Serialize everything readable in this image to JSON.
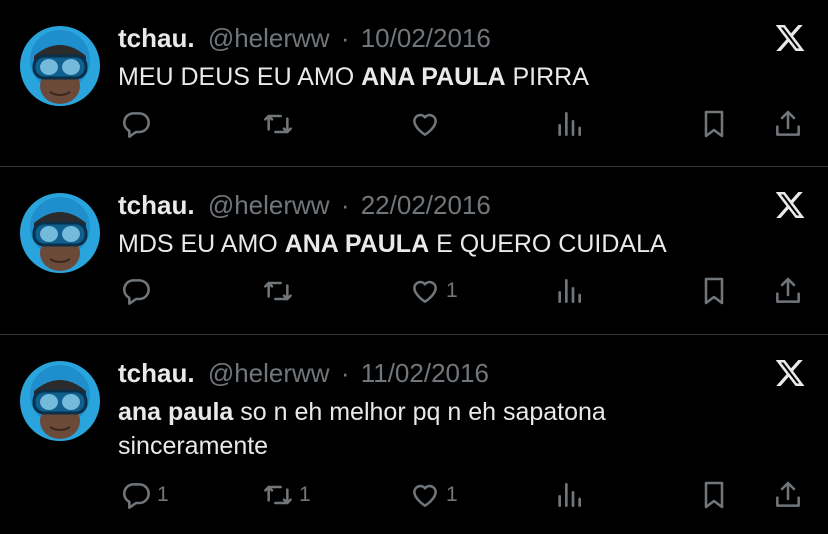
{
  "tweets": [
    {
      "name": "tchau.",
      "handle": "@helerww",
      "sep": "·",
      "date": "10/02/2016",
      "text_pre": "MEU DEUS EU AMO ",
      "text_bold": "ANA PAULA",
      "text_post": " PIRRA",
      "counts": {
        "reply": "",
        "retweet": "",
        "like": ""
      }
    },
    {
      "name": "tchau.",
      "handle": "@helerww",
      "sep": "·",
      "date": "22/02/2016",
      "text_pre": "MDS EU AMO ",
      "text_bold": "ANA PAULA",
      "text_post": " E QUERO CUIDALA",
      "counts": {
        "reply": "",
        "retweet": "",
        "like": "1"
      }
    },
    {
      "name": "tchau.",
      "handle": "@helerww",
      "sep": "·",
      "date": "11/02/2016",
      "text_pre": "",
      "text_bold": "ana paula",
      "text_post": " so n eh melhor pq n eh sapatona sinceramente",
      "counts": {
        "reply": "1",
        "retweet": "1",
        "like": "1"
      }
    }
  ],
  "icons": {
    "reply": "comment-icon",
    "retweet": "retweet-icon",
    "like": "heart-icon",
    "views": "views-icon",
    "bookmark": "bookmark-icon",
    "share": "share-icon",
    "logo": "x-logo-icon"
  },
  "colors": {
    "background": "#000000",
    "text": "#e7e9ea",
    "muted": "#71767b",
    "divider": "#2f3336"
  }
}
